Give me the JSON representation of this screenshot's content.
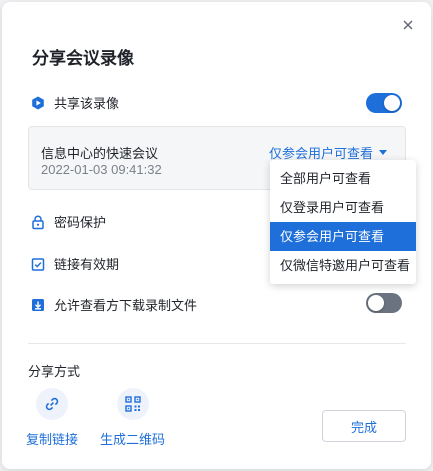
{
  "dialog": {
    "title": "分享会议录像",
    "share_toggle": {
      "label": "共享该录像",
      "on": true
    },
    "meeting": {
      "name": "信息中心的快速会议",
      "time": "2022-01-03 09:41:32",
      "permission": "仅参会用户可查看"
    },
    "permission_options": [
      {
        "label": "全部用户可查看",
        "selected": false
      },
      {
        "label": "仅登录用户可查看",
        "selected": false
      },
      {
        "label": "仅参会用户可查看",
        "selected": true
      },
      {
        "label": "仅微信特邀用户可查看",
        "selected": false
      }
    ],
    "password_label": "密码保护",
    "validity_label": "链接有效期",
    "download_toggle": {
      "label": "允许查看方下载录制文件",
      "on": false
    },
    "share_method_label": "分享方式",
    "actions": {
      "copy_link": "复制链接",
      "qr_code": "生成二维码",
      "done": "完成"
    }
  },
  "colors": {
    "accent": "#1e6fd9",
    "toggle_off": "#6b7380"
  },
  "icons": {
    "close": "close-icon",
    "share": "play-share-icon",
    "password": "lock-icon",
    "validity": "calendar-check-icon",
    "download": "download-icon",
    "copy_link": "link-icon",
    "qr_code": "qr-code-icon"
  }
}
